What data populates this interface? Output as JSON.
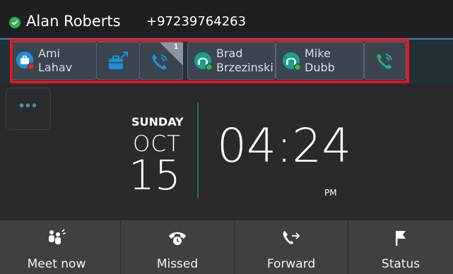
{
  "header": {
    "user_name": "Alan Roberts",
    "user_number": "+97239764263",
    "status_color": "#2fb34a"
  },
  "line_keys": [
    {
      "type": "contact",
      "icon": "away-contact-icon",
      "first": "Ami",
      "last": "Lahav",
      "presence_color": "#e02424"
    },
    {
      "type": "action",
      "icon": "transfer-briefcase-icon"
    },
    {
      "type": "line",
      "icon": "phone-icon",
      "badge": "1"
    },
    {
      "type": "contact",
      "icon": "headset-contact-icon",
      "first": "Brad",
      "last": "Brzezinski",
      "presence_color": "#2fb34a"
    },
    {
      "type": "contact",
      "icon": "headset-contact-icon",
      "first": "Mike",
      "last": "Dubb",
      "presence_color": "#2fb34a"
    },
    {
      "type": "line",
      "icon": "phone-icon-green"
    }
  ],
  "clock": {
    "day": "SUNDAY",
    "month": "OCT",
    "date": "15",
    "time": "04:24",
    "ampm": "PM"
  },
  "softkeys": [
    {
      "label": "Meet now",
      "icon": "meet-now-icon"
    },
    {
      "label": "Missed",
      "icon": "missed-call-icon"
    },
    {
      "label": "Forward",
      "icon": "forward-icon"
    },
    {
      "label": "Status",
      "icon": "flag-icon"
    }
  ],
  "more_button": {
    "icon": "more-dots-icon"
  },
  "colors": {
    "accent": "#3c87b0",
    "selection": "#e5161c",
    "teal": "#1f6f6a"
  }
}
